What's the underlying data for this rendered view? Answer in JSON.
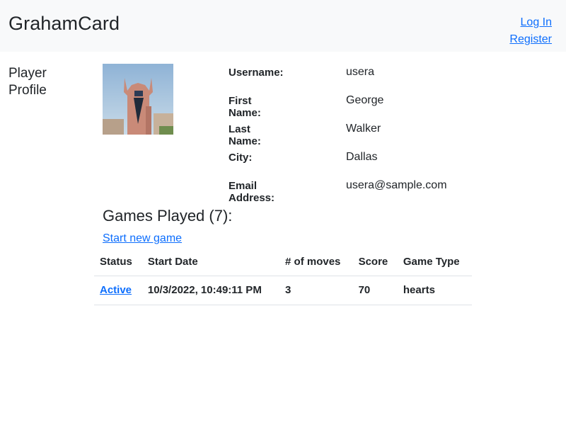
{
  "header": {
    "brand": "GrahamCard",
    "login_label": "Log In",
    "register_label": "Register"
  },
  "sidebar": {
    "title": "Player Profile"
  },
  "profile": {
    "avatar_icon": "building-photo",
    "fields": [
      {
        "label": "Username:",
        "value": "usera"
      },
      {
        "label": "First Name:",
        "value": "George"
      },
      {
        "label": "Last Name:",
        "value": "Walker"
      },
      {
        "label": "City:",
        "value": "Dallas"
      },
      {
        "label": "Email Address:",
        "value": "usera@sample.com"
      }
    ]
  },
  "games": {
    "heading": "Games Played (7):",
    "new_game_label": "Start new game",
    "columns": [
      "Status",
      "Start Date",
      "# of moves",
      "Score",
      "Game Type"
    ],
    "rows": [
      {
        "status": "Active",
        "start_date": "10/3/2022, 10:49:11 PM",
        "moves": "3",
        "score": "70",
        "game_type": "hearts"
      }
    ]
  },
  "colors": {
    "link": "#0d6efd",
    "navbar_bg": "#f8f9fa",
    "text": "#212529"
  }
}
